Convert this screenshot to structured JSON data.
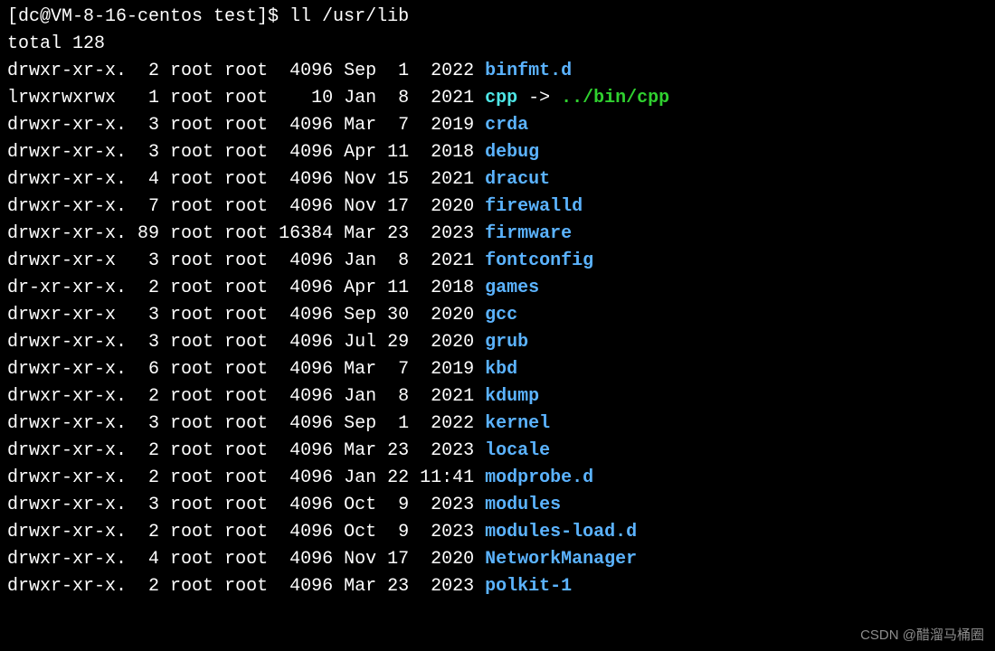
{
  "prompt": "[dc@VM-8-16-centos test]$ ll /usr/lib",
  "total": "total 128",
  "rows": [
    {
      "perms": "drwxr-xr-x.",
      "links": " 2",
      "owner": "root",
      "group": "root",
      "size": " 4096",
      "date": "Sep  1  2022",
      "name": "binfmt.d",
      "type": "dir"
    },
    {
      "perms": "lrwxrwxrwx ",
      "links": " 1",
      "owner": "root",
      "group": "root",
      "size": "   10",
      "date": "Jan  8  2021",
      "name": "cpp",
      "type": "symlink",
      "arrow": " -> ",
      "target": "../bin/cpp"
    },
    {
      "perms": "drwxr-xr-x.",
      "links": " 3",
      "owner": "root",
      "group": "root",
      "size": " 4096",
      "date": "Mar  7  2019",
      "name": "crda",
      "type": "dir"
    },
    {
      "perms": "drwxr-xr-x.",
      "links": " 3",
      "owner": "root",
      "group": "root",
      "size": " 4096",
      "date": "Apr 11  2018",
      "name": "debug",
      "type": "dir"
    },
    {
      "perms": "drwxr-xr-x.",
      "links": " 4",
      "owner": "root",
      "group": "root",
      "size": " 4096",
      "date": "Nov 15  2021",
      "name": "dracut",
      "type": "dir"
    },
    {
      "perms": "drwxr-xr-x.",
      "links": " 7",
      "owner": "root",
      "group": "root",
      "size": " 4096",
      "date": "Nov 17  2020",
      "name": "firewalld",
      "type": "dir"
    },
    {
      "perms": "drwxr-xr-x.",
      "links": "89",
      "owner": "root",
      "group": "root",
      "size": "16384",
      "date": "Mar 23  2023",
      "name": "firmware",
      "type": "dir"
    },
    {
      "perms": "drwxr-xr-x ",
      "links": " 3",
      "owner": "root",
      "group": "root",
      "size": " 4096",
      "date": "Jan  8  2021",
      "name": "fontconfig",
      "type": "dir"
    },
    {
      "perms": "dr-xr-xr-x.",
      "links": " 2",
      "owner": "root",
      "group": "root",
      "size": " 4096",
      "date": "Apr 11  2018",
      "name": "games",
      "type": "dir"
    },
    {
      "perms": "drwxr-xr-x ",
      "links": " 3",
      "owner": "root",
      "group": "root",
      "size": " 4096",
      "date": "Sep 30  2020",
      "name": "gcc",
      "type": "dir"
    },
    {
      "perms": "drwxr-xr-x.",
      "links": " 3",
      "owner": "root",
      "group": "root",
      "size": " 4096",
      "date": "Jul 29  2020",
      "name": "grub",
      "type": "dir"
    },
    {
      "perms": "drwxr-xr-x.",
      "links": " 6",
      "owner": "root",
      "group": "root",
      "size": " 4096",
      "date": "Mar  7  2019",
      "name": "kbd",
      "type": "dir"
    },
    {
      "perms": "drwxr-xr-x.",
      "links": " 2",
      "owner": "root",
      "group": "root",
      "size": " 4096",
      "date": "Jan  8  2021",
      "name": "kdump",
      "type": "dir"
    },
    {
      "perms": "drwxr-xr-x.",
      "links": " 3",
      "owner": "root",
      "group": "root",
      "size": " 4096",
      "date": "Sep  1  2022",
      "name": "kernel",
      "type": "dir"
    },
    {
      "perms": "drwxr-xr-x.",
      "links": " 2",
      "owner": "root",
      "group": "root",
      "size": " 4096",
      "date": "Mar 23  2023",
      "name": "locale",
      "type": "dir"
    },
    {
      "perms": "drwxr-xr-x.",
      "links": " 2",
      "owner": "root",
      "group": "root",
      "size": " 4096",
      "date": "Jan 22 11:41",
      "name": "modprobe.d",
      "type": "dir"
    },
    {
      "perms": "drwxr-xr-x.",
      "links": " 3",
      "owner": "root",
      "group": "root",
      "size": " 4096",
      "date": "Oct  9  2023",
      "name": "modules",
      "type": "dir"
    },
    {
      "perms": "drwxr-xr-x.",
      "links": " 2",
      "owner": "root",
      "group": "root",
      "size": " 4096",
      "date": "Oct  9  2023",
      "name": "modules-load.d",
      "type": "dir"
    },
    {
      "perms": "drwxr-xr-x.",
      "links": " 4",
      "owner": "root",
      "group": "root",
      "size": " 4096",
      "date": "Nov 17  2020",
      "name": "NetworkManager",
      "type": "dir"
    },
    {
      "perms": "drwxr-xr-x.",
      "links": " 2",
      "owner": "root",
      "group": "root",
      "size": " 4096",
      "date": "Mar 23  2023",
      "name": "polkit-1",
      "type": "dir"
    }
  ],
  "watermark": "CSDN @醋溜马桶圈"
}
